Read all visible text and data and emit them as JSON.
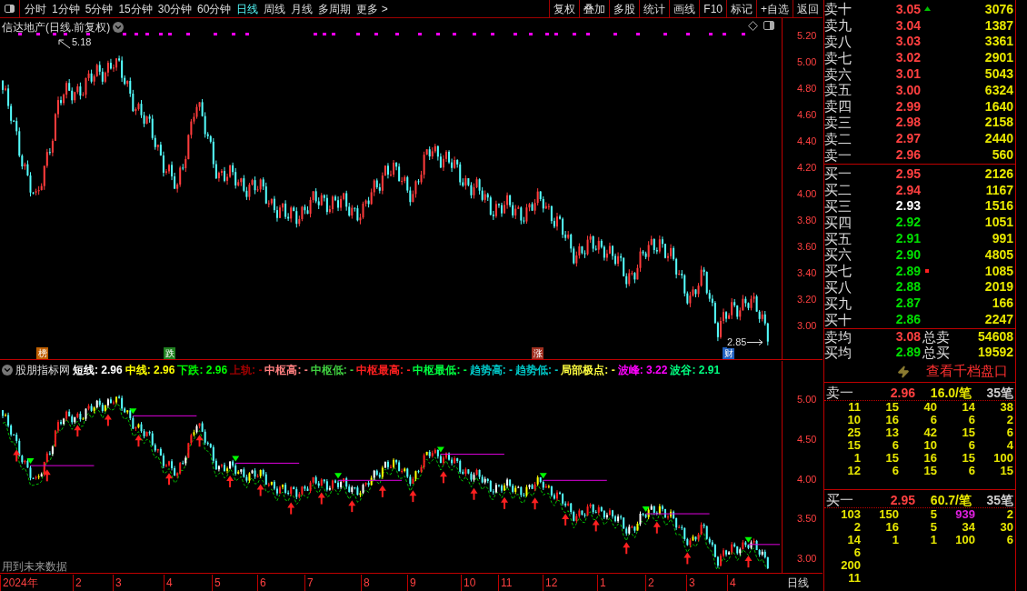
{
  "toolbar": {
    "periods": [
      {
        "label": "分时",
        "selected": false
      },
      {
        "label": "1分钟",
        "selected": false
      },
      {
        "label": "5分钟",
        "selected": false
      },
      {
        "label": "15分钟",
        "selected": false
      },
      {
        "label": "30分钟",
        "selected": false
      },
      {
        "label": "60分钟",
        "selected": false
      },
      {
        "label": "日线",
        "selected": true
      },
      {
        "label": "周线",
        "selected": false
      },
      {
        "label": "月线",
        "selected": false
      },
      {
        "label": "多周期",
        "selected": false
      },
      {
        "label": "更多 >",
        "selected": false
      }
    ],
    "buttons": [
      "复权",
      "叠加",
      "多股",
      "统计",
      "画线",
      "F10",
      "标记",
      "+自选",
      "返回"
    ]
  },
  "main_chart": {
    "title": "信达地产(日线.前复权)",
    "high_label": "5.18",
    "low_label": "2.85",
    "yticks": [
      "5.20",
      "5.00",
      "4.80",
      "4.60",
      "4.40",
      "4.20",
      "4.00",
      "3.80",
      "3.60",
      "3.40",
      "3.20",
      "3.00"
    ],
    "events": [
      {
        "label": "榜",
        "color": "#c06000"
      },
      {
        "label": "跌",
        "color": "#208020"
      },
      {
        "label": "涨",
        "color": "#a03020"
      },
      {
        "label": "财",
        "color": "#2060c0"
      }
    ]
  },
  "indicator": {
    "name": "股朋指标网",
    "legend": [
      {
        "label": "短线: 2.96",
        "color": "#ffffff"
      },
      {
        "label": "中线: 2.96",
        "color": "#ffff00"
      },
      {
        "label": "下跌: 2.96",
        "color": "#00ff00"
      },
      {
        "label": "上轨: -",
        "color": "#a00000"
      },
      {
        "label": "中枢高: -",
        "color": "#ff8080"
      },
      {
        "label": "中枢低: -",
        "color": "#40d040"
      },
      {
        "label": "中枢最高: -",
        "color": "#ff2020"
      },
      {
        "label": "中枢最低: -",
        "color": "#00ff40"
      },
      {
        "label": "趋势高: -",
        "color": "#00c8c8"
      },
      {
        "label": "趋势低: -",
        "color": "#00c8c8"
      },
      {
        "label": "局部极点: -",
        "color": "#ffff40"
      },
      {
        "label": "波峰: 3.22",
        "color": "#ff00ff"
      },
      {
        "label": "波谷: 2.91",
        "color": "#00ff80"
      }
    ],
    "yticks": [
      "5.00",
      "4.50",
      "4.00",
      "3.50",
      "3.00"
    ],
    "note": "用到未来数据"
  },
  "date_axis": {
    "labels": [
      "2024年",
      "2",
      "3",
      "4",
      "5",
      "6",
      "7",
      "8",
      "9",
      "10",
      "11",
      "12",
      "1",
      "2",
      "3",
      "4"
    ],
    "period": "日线"
  },
  "order_book": {
    "asks": [
      {
        "label": "卖十",
        "price": "3.05",
        "color": "#ff4040",
        "volume": "3076",
        "kind": "up"
      },
      {
        "label": "卖九",
        "price": "3.04",
        "color": "#ff4040",
        "volume": "1387"
      },
      {
        "label": "卖八",
        "price": "3.03",
        "color": "#ff4040",
        "volume": "3361"
      },
      {
        "label": "卖七",
        "price": "3.02",
        "color": "#ff4040",
        "volume": "2901"
      },
      {
        "label": "卖六",
        "price": "3.01",
        "color": "#ff4040",
        "volume": "5043"
      },
      {
        "label": "卖五",
        "price": "3.00",
        "color": "#ff4040",
        "volume": "6324"
      },
      {
        "label": "卖四",
        "price": "2.99",
        "color": "#ff4040",
        "volume": "1640"
      },
      {
        "label": "卖三",
        "price": "2.98",
        "color": "#ff4040",
        "volume": "2158"
      },
      {
        "label": "卖二",
        "price": "2.97",
        "color": "#ff4040",
        "volume": "2440"
      },
      {
        "label": "卖一",
        "price": "2.96",
        "color": "#ff4040",
        "volume": "560"
      }
    ],
    "bids": [
      {
        "label": "买一",
        "price": "2.95",
        "color": "#ff4040",
        "volume": "2126"
      },
      {
        "label": "买二",
        "price": "2.94",
        "color": "#ff4040",
        "volume": "1167"
      },
      {
        "label": "买三",
        "price": "2.93",
        "color": "#ffffff",
        "volume": "1516"
      },
      {
        "label": "买四",
        "price": "2.92",
        "color": "#00e000",
        "volume": "1051"
      },
      {
        "label": "买五",
        "price": "2.91",
        "color": "#00e000",
        "volume": "991"
      },
      {
        "label": "买六",
        "price": "2.90",
        "color": "#00e000",
        "volume": "4805"
      },
      {
        "label": "买七",
        "price": "2.89",
        "color": "#00e000",
        "volume": "1085",
        "kind": "dot"
      },
      {
        "label": "买八",
        "price": "2.88",
        "color": "#00e000",
        "volume": "2019"
      },
      {
        "label": "买九",
        "price": "2.87",
        "color": "#00e000",
        "volume": "166"
      },
      {
        "label": "买十",
        "price": "2.86",
        "color": "#00e000",
        "volume": "2247"
      }
    ],
    "summary": [
      {
        "label": "卖均",
        "price": "3.08",
        "color": "#ff4040",
        "total_label": "总卖",
        "total": "54608"
      },
      {
        "label": "买均",
        "price": "2.89",
        "color": "#00e000",
        "total_label": "总买",
        "total": "19592"
      }
    ]
  },
  "depth": {
    "link": "查看千档盘口",
    "sections": [
      {
        "label": "卖一",
        "price": "2.96",
        "avg": "16.0/笔",
        "count": "35笔",
        "rows": [
          [
            "11",
            "15",
            "40",
            "14",
            "38"
          ],
          [
            "10",
            "16",
            "6",
            "6",
            "2"
          ],
          [
            "25",
            "13",
            "42",
            "15",
            "6"
          ],
          [
            "15",
            "6",
            "10",
            "6",
            "4"
          ],
          [
            "1",
            "15",
            "16",
            "15",
            "100"
          ],
          [
            "12",
            "6",
            "15",
            "6",
            "15"
          ]
        ]
      },
      {
        "label": "买一",
        "price": "2.95",
        "avg": "60.7/笔",
        "count": "35笔",
        "rows": [
          [
            "103",
            "150",
            "5",
            {
              "text": "939",
              "color": "#e020e0"
            },
            "2"
          ],
          [
            "2",
            "16",
            "5",
            "34",
            "30"
          ],
          [
            "14",
            "1",
            "1",
            "100",
            "6"
          ],
          [
            "6"
          ],
          [
            "200"
          ],
          [
            "11"
          ]
        ]
      }
    ]
  }
}
